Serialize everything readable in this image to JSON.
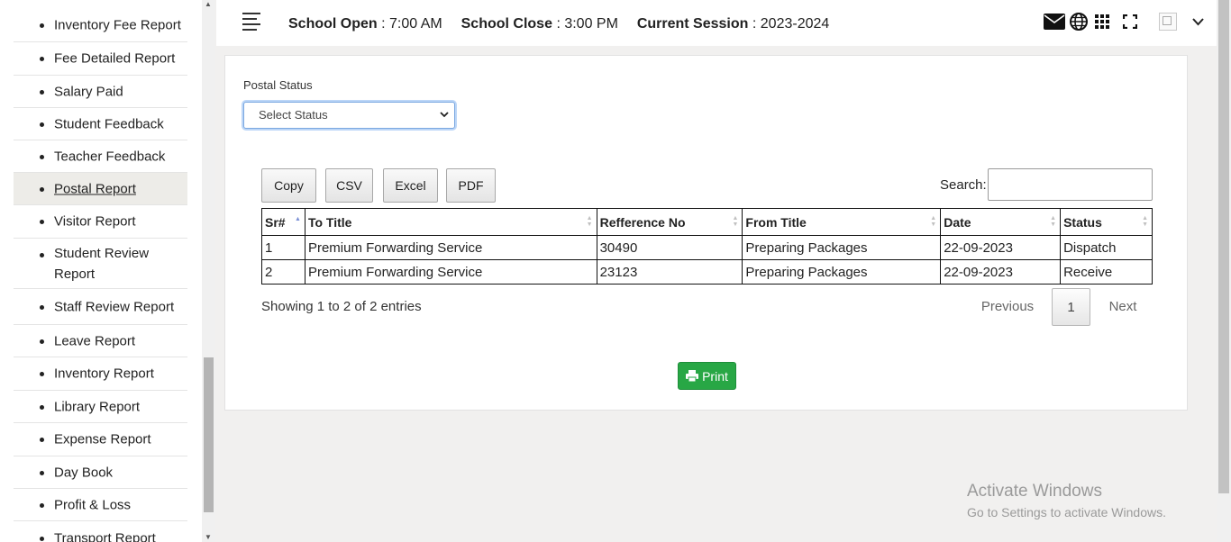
{
  "sidebar": {
    "items": [
      {
        "label": "Inventory Fee Report"
      },
      {
        "label": "Fee Detailed Report"
      },
      {
        "label": "Salary Paid"
      },
      {
        "label": "Student Feedback"
      },
      {
        "label": "Teacher Feedback"
      },
      {
        "label": "Postal Report",
        "active": true
      },
      {
        "label": "Visitor Report"
      },
      {
        "label": "Student Review Report"
      },
      {
        "label": "Staff Review Report"
      },
      {
        "label": "Leave Report"
      },
      {
        "label": "Inventory Report"
      },
      {
        "label": "Library Report"
      },
      {
        "label": "Expense Report"
      },
      {
        "label": "Day Book"
      },
      {
        "label": "Profit & Loss"
      },
      {
        "label": "Transport Report"
      }
    ]
  },
  "header": {
    "school_open_label": "School Open",
    "school_open_value": ": 7:00 AM",
    "school_close_label": "School Close",
    "school_close_value": ": 3:00 PM",
    "session_label": "Current Session",
    "session_value": ": 2023-2024",
    "icons": [
      "menu-icon",
      "mail-icon",
      "globe-icon",
      "apps-grid-icon",
      "fullscreen-icon",
      "chevron-down-icon"
    ]
  },
  "filter": {
    "label": "Postal Status",
    "select_value": "Select Status"
  },
  "toolbar": {
    "copy": "Copy",
    "csv": "CSV",
    "excel": "Excel",
    "pdf": "PDF",
    "search_label": "Search:",
    "search_value": ""
  },
  "table": {
    "columns": [
      "Sr#",
      "To Title",
      "Refference No",
      "From Title",
      "Date",
      "Status"
    ],
    "rows": [
      [
        "1",
        "Premium Forwarding Service",
        "30490",
        "Preparing Packages",
        "22-09-2023",
        "Dispatch"
      ],
      [
        "2",
        "Premium Forwarding Service",
        "23123",
        "Preparing Packages",
        "22-09-2023",
        "Receive"
      ]
    ]
  },
  "pagination": {
    "info": "Showing 1 to 2 of 2 entries",
    "previous": "Previous",
    "current_page": "1",
    "next": "Next"
  },
  "print_label": "Print",
  "watermark": {
    "line1": "Activate Windows",
    "line2": "Go to Settings to activate Windows."
  },
  "colors": {
    "accent_green": "#28a745",
    "sort_active": "#7a8fd6"
  }
}
